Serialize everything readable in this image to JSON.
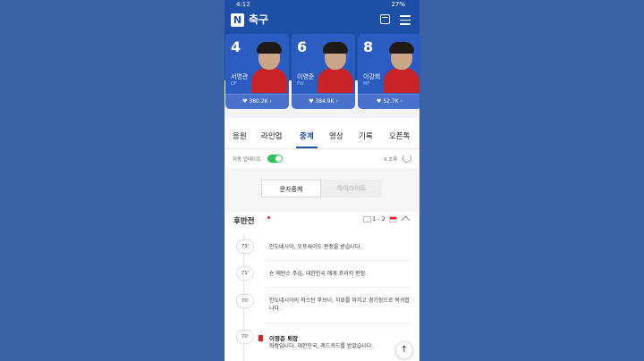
{
  "status": {
    "time": "4:12",
    "right": "27%"
  },
  "header": {
    "title": "축구"
  },
  "players": [
    {
      "number": "4",
      "name": "서명관",
      "position": "DF",
      "likes": "380.2K"
    },
    {
      "number": "6",
      "name": "이영준",
      "position": "FW",
      "likes": "384.9K"
    },
    {
      "number": "8",
      "name": "이강희",
      "position": "MF",
      "likes": "52.7K"
    }
  ],
  "tabs": [
    "응원",
    "라인업",
    "중계",
    "영상",
    "기록",
    "오픈톡"
  ],
  "auto_update": {
    "label": "자동 업데이트",
    "seconds": "9 초후"
  },
  "segments": {
    "live_text": "문자중계",
    "highlight": "하이라이트"
  },
  "half": {
    "label": "후반전",
    "score": "1 - 2"
  },
  "events": [
    {
      "minute": "73'",
      "text": "인도네시아, 오프사이드 판정을 받습니다."
    },
    {
      "minute": "71'",
      "text": "숀 에반스 주심, 대한민국 에게 프리킥 판정."
    },
    {
      "minute": "70'",
      "text": "인도네시아의 저스틴 후브너, 치료를 마치고 경기장으로 복귀합니다."
    },
    {
      "minute": "70'",
      "title": "이영준 퇴장",
      "text": "퇴장입니다. 대한민국, 레드카드를 받았습니다."
    }
  ],
  "colors": {
    "brand": "#1e4fa6",
    "background": "#3b61a6",
    "toggle": "#2ec05a",
    "red_card": "#d8252a"
  }
}
